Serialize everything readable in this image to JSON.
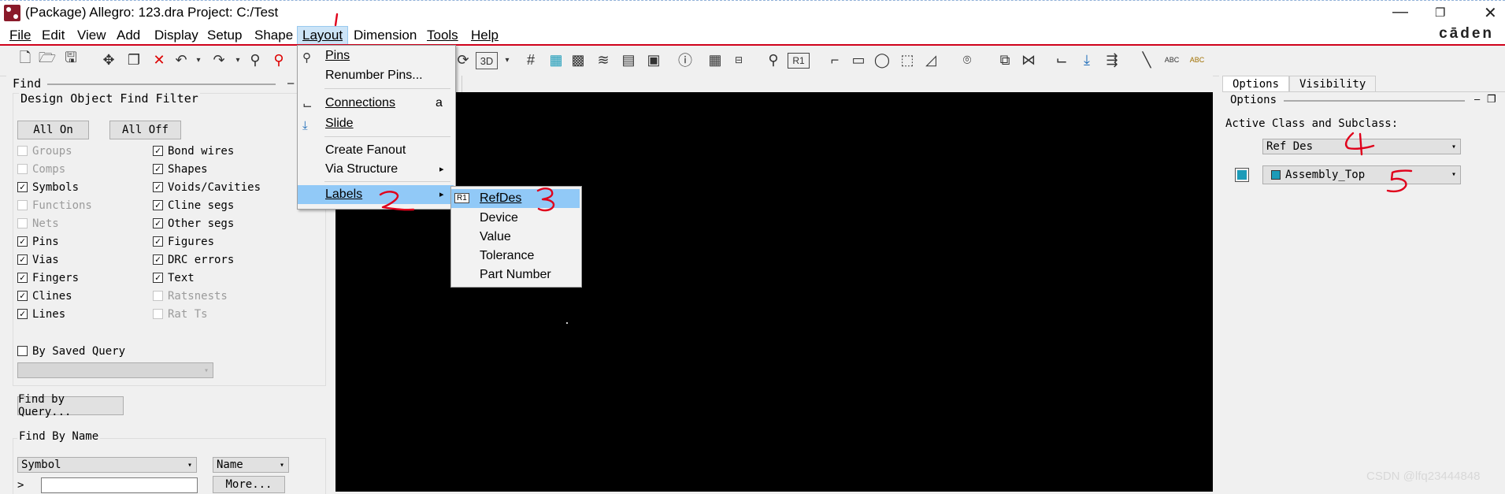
{
  "window": {
    "title": "(Package) Allegro: 123.dra  Project: C:/Test",
    "minimize": "—",
    "restore": "❐",
    "close": "✕",
    "brand": "cāden"
  },
  "menubar": [
    "File",
    "Edit",
    "View",
    "Add",
    "Display",
    "Setup",
    "Shape",
    "Layout",
    "Dimension",
    "Tools",
    "Help"
  ],
  "layout_menu": {
    "items": [
      {
        "label": "Pins",
        "icon": "pins-icon",
        "shortcut": ""
      },
      {
        "label": "Renumber Pins...",
        "icon": "",
        "shortcut": ""
      },
      {
        "label": "Connections",
        "icon": "connections-icon",
        "shortcut": "a"
      },
      {
        "label": "Slide",
        "icon": "slide-icon",
        "shortcut": ""
      },
      {
        "label": "Create Fanout",
        "icon": "",
        "shortcut": ""
      },
      {
        "label": "Via Structure",
        "icon": "",
        "shortcut": "▸"
      },
      {
        "label": "Labels",
        "icon": "",
        "shortcut": "▸"
      }
    ],
    "labels_submenu": [
      {
        "label": "RefDes",
        "icon_text": "R1"
      },
      {
        "label": "Device"
      },
      {
        "label": "Value"
      },
      {
        "label": "Tolerance"
      },
      {
        "label": "Part Number"
      }
    ]
  },
  "toolbar": {
    "view_3d": "3D",
    "r1": "R1",
    "abc": "ABC"
  },
  "find_panel": {
    "header": "Find",
    "collapse": "–",
    "filter_title": "Design Object Find Filter",
    "all_on": "All On",
    "all_off": "All Off",
    "left_col": [
      {
        "label": "Groups",
        "checked": false,
        "enabled": false
      },
      {
        "label": "Comps",
        "checked": false,
        "enabled": false
      },
      {
        "label": "Symbols",
        "checked": true,
        "enabled": true
      },
      {
        "label": "Functions",
        "checked": false,
        "enabled": false
      },
      {
        "label": "Nets",
        "checked": false,
        "enabled": false
      },
      {
        "label": "Pins",
        "checked": true,
        "enabled": true
      },
      {
        "label": "Vias",
        "checked": true,
        "enabled": true
      },
      {
        "label": "Fingers",
        "checked": true,
        "enabled": true
      },
      {
        "label": "Clines",
        "checked": true,
        "enabled": true
      },
      {
        "label": "Lines",
        "checked": true,
        "enabled": true
      }
    ],
    "right_col": [
      {
        "label": "Bond wires",
        "checked": true,
        "enabled": true
      },
      {
        "label": "Shapes",
        "checked": true,
        "enabled": true
      },
      {
        "label": "Voids/Cavities",
        "checked": true,
        "enabled": true
      },
      {
        "label": "Cline segs",
        "checked": true,
        "enabled": true
      },
      {
        "label": "Other segs",
        "checked": true,
        "enabled": true
      },
      {
        "label": "Figures",
        "checked": true,
        "enabled": true
      },
      {
        "label": "DRC errors",
        "checked": true,
        "enabled": true
      },
      {
        "label": "Text",
        "checked": true,
        "enabled": true
      },
      {
        "label": "Ratsnests",
        "checked": false,
        "enabled": false
      },
      {
        "label": "Rat Ts",
        "checked": false,
        "enabled": false
      }
    ],
    "by_saved_query": "By Saved Query",
    "find_by_query": "Find by Query...",
    "find_by_name": "Find By Name",
    "type_select": "Symbol",
    "name_select": "Name",
    "expand": ">",
    "name_input": "",
    "more_button": "More..."
  },
  "options_panel": {
    "tabs": [
      "Options",
      "Visibility"
    ],
    "header": "Options",
    "active_class_label": "Active Class and Subclass:",
    "class_value": "Ref Des",
    "subclass_value": "Assembly_Top",
    "subclass_color": "#1c9bb8"
  },
  "annotations": [
    "1",
    "2",
    "3",
    "4",
    "5"
  ],
  "watermark": "CSDN @lfq23444848"
}
